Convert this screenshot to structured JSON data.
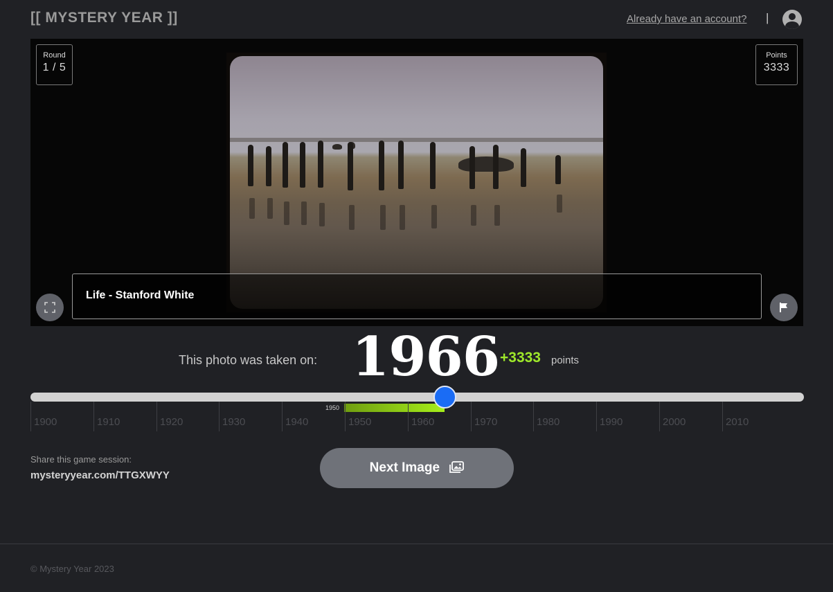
{
  "header": {
    "logo": "[[ MYSTERY YEAR ]]",
    "account_link": "Already have an account?",
    "separator": "|",
    "avatar_icon": "user-circle-icon"
  },
  "game": {
    "round_label": "Round",
    "round_value": "1 / 5",
    "points_label": "Points",
    "points_value": "3333",
    "caption": "Life - Stanford White",
    "fullscreen_icon": "fullscreen-icon",
    "flag_icon": "flag-icon"
  },
  "result": {
    "taken_label": "This photo was taken on:",
    "year": "1966",
    "points_gain": "+3333",
    "points_word": "points"
  },
  "timeline": {
    "ticks": [
      "1900",
      "1910",
      "1920",
      "1930",
      "1940",
      "1950",
      "1960",
      "1970",
      "1980",
      "1990",
      "2000",
      "2010"
    ],
    "range_start_label": "1950",
    "accent_color": "#1a6cf5",
    "range_color": "#a6ef1a"
  },
  "share": {
    "label": "Share this game session:",
    "link": "mysteryyear.com/TTGXWYY"
  },
  "next_button": {
    "label": "Next Image",
    "icon": "images-icon"
  },
  "footer": {
    "copyright": "© Mystery Year 2023"
  }
}
